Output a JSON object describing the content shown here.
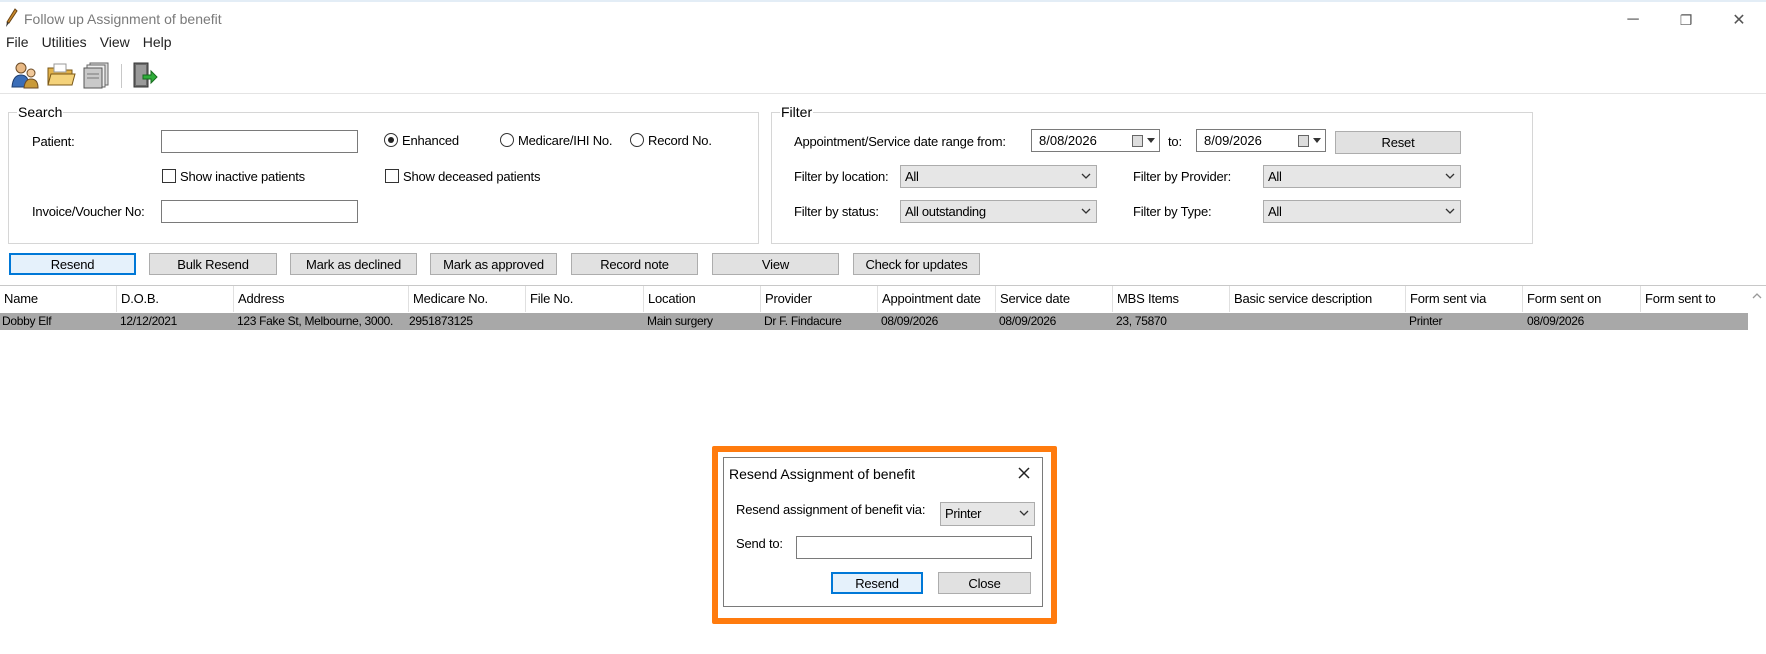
{
  "window": {
    "title": "Follow up Assignment of benefit",
    "controls": {
      "minimize": "─",
      "restore": "❐",
      "close": "✕"
    }
  },
  "menu": [
    "File",
    "Utilities",
    "View",
    "Help"
  ],
  "toolbar": {
    "icons": [
      "patients-icon",
      "open-folder-icon",
      "printer-stack-icon",
      "exit-door-icon"
    ]
  },
  "search": {
    "legend": "Search",
    "patient_label": "Patient:",
    "patient_value": "",
    "radio_enhanced": "Enhanced",
    "radio_medicare": "Medicare/IHI No.",
    "radio_record": "Record No.",
    "selected_radio": "Enhanced",
    "show_inactive": "Show inactive patients",
    "show_deceased": "Show deceased patients",
    "invoice_label": "Invoice/Voucher No:",
    "invoice_value": ""
  },
  "filter": {
    "legend": "Filter",
    "date_range_label": "Appointment/Service date range from:",
    "date_from": "8/08/2026",
    "to_label": "to:",
    "date_to": "8/09/2026",
    "reset_label": "Reset",
    "location_label": "Filter by location:",
    "location_value": "All",
    "provider_label": "Filter by Provider:",
    "provider_value": "All",
    "status_label": "Filter by status:",
    "status_value": "All outstanding",
    "type_label": "Filter by Type:",
    "type_value": "All"
  },
  "actions": {
    "resend": "Resend",
    "bulk_resend": "Bulk Resend",
    "mark_declined": "Mark as declined",
    "mark_approved": "Mark as approved",
    "record_note": "Record note",
    "view": "View",
    "check_updates": "Check for updates"
  },
  "grid": {
    "columns": [
      "Name",
      "D.O.B.",
      "Address",
      "Medicare No.",
      "File No.",
      "Location",
      "Provider",
      "Appointment date",
      "Service date",
      "MBS Items",
      "Basic service description",
      "Form sent via",
      "Form sent on",
      "Form sent to"
    ],
    "rows": [
      [
        "Dobby Elf",
        "12/12/2021",
        "123 Fake St, Melbourne, 3000.",
        "2951873125",
        "",
        "Main surgery",
        "Dr F. Findacure",
        "08/09/2026",
        "08/09/2026",
        "23, 75870",
        "",
        "Printer",
        "08/09/2026",
        ""
      ]
    ]
  },
  "dialog": {
    "title": "Resend Assignment of benefit",
    "via_label": "Resend assignment of benefit via:",
    "via_value": "Printer",
    "send_to_label": "Send to:",
    "send_to_value": "",
    "resend_label": "Resend",
    "close_label": "Close"
  },
  "colors": {
    "highlight": "#ff7b0e",
    "default_button_border": "#0078d7",
    "selected_row": "#a8a8a8"
  }
}
